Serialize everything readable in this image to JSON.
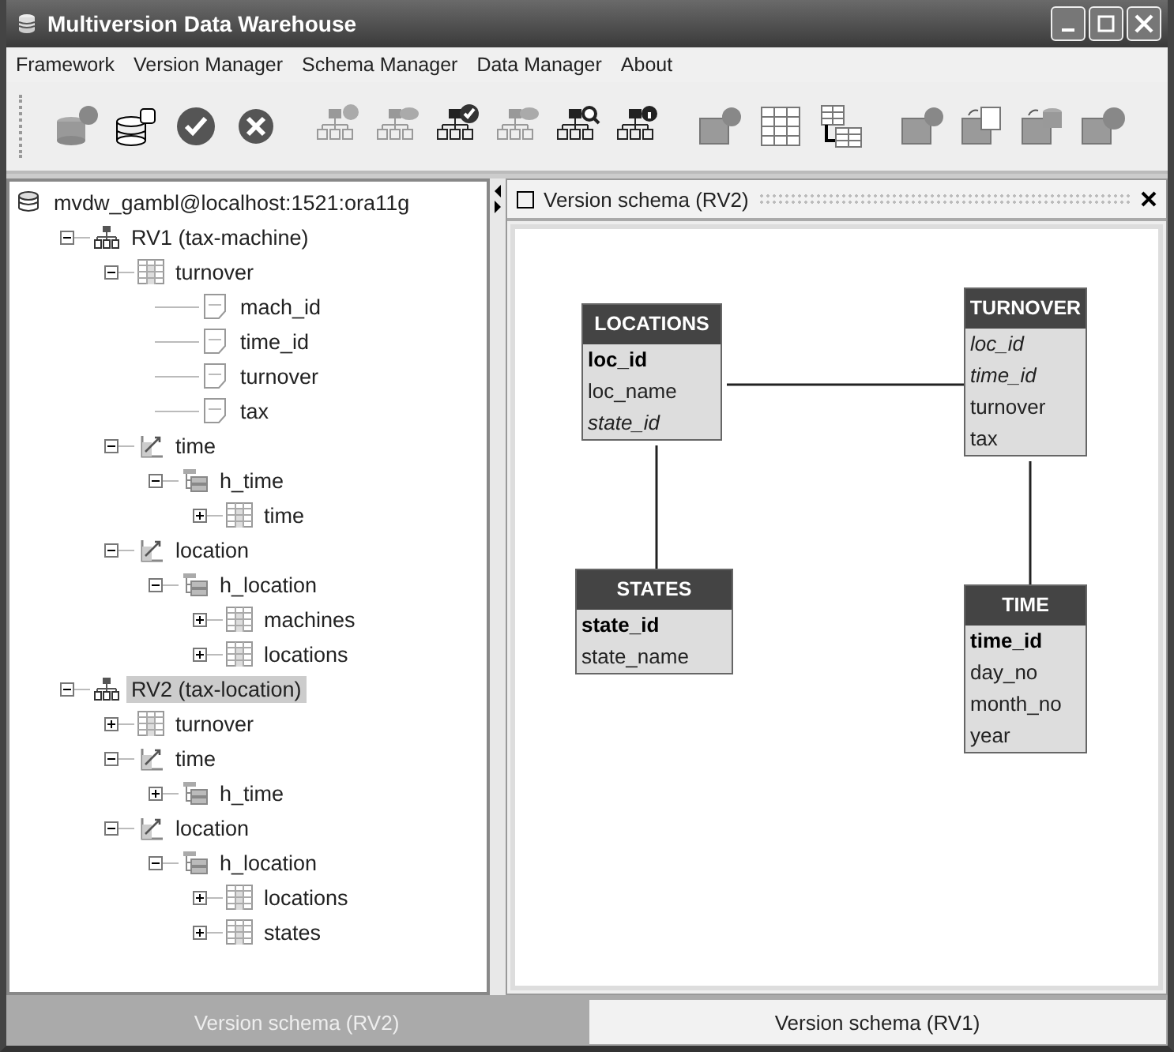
{
  "window": {
    "title": "Multiversion Data Warehouse"
  },
  "menu": [
    "Framework",
    "Version Manager",
    "Schema Manager",
    "Data Manager",
    "About"
  ],
  "toolbar": [
    [
      {
        "kind": "db-add"
      },
      {
        "kind": "db-connect"
      },
      {
        "kind": "ok"
      },
      {
        "kind": "cancel"
      }
    ],
    [
      {
        "kind": "version-add"
      },
      {
        "kind": "version-edit"
      },
      {
        "kind": "version-check"
      },
      {
        "kind": "version-remove"
      },
      {
        "kind": "version-search"
      },
      {
        "kind": "version-info"
      }
    ],
    [
      {
        "kind": "cube-search"
      },
      {
        "kind": "table"
      },
      {
        "kind": "table-link"
      }
    ],
    [
      {
        "kind": "cube-search"
      },
      {
        "kind": "cube-undo"
      },
      {
        "kind": "cube-db"
      },
      {
        "kind": "cube-play"
      }
    ]
  ],
  "tree": {
    "label": "mvdw_gambl@localhost:1521:ora11g",
    "kind": "database",
    "selected": false,
    "children": [
      {
        "label": "RV1 (tax-machine)",
        "kind": "version",
        "expanded": true,
        "selected": false,
        "children": [
          {
            "label": "turnover",
            "kind": "table",
            "expanded": true,
            "selected": false,
            "children": [
              {
                "label": "mach_id",
                "kind": "column",
                "selected": false
              },
              {
                "label": "time_id",
                "kind": "column",
                "selected": false
              },
              {
                "label": "turnover",
                "kind": "column",
                "selected": false
              },
              {
                "label": "tax",
                "kind": "column",
                "selected": false
              }
            ]
          },
          {
            "label": "time",
            "kind": "dimension",
            "expanded": true,
            "selected": false,
            "children": [
              {
                "label": "h_time",
                "kind": "hierarchy",
                "expanded": true,
                "selected": false,
                "children": [
                  {
                    "label": "time",
                    "kind": "table",
                    "expanded": false,
                    "selected": false
                  }
                ]
              }
            ]
          },
          {
            "label": "location",
            "kind": "dimension",
            "expanded": true,
            "selected": false,
            "children": [
              {
                "label": "h_location",
                "kind": "hierarchy",
                "expanded": true,
                "selected": false,
                "children": [
                  {
                    "label": "machines",
                    "kind": "table",
                    "expanded": false,
                    "selected": false
                  },
                  {
                    "label": "locations",
                    "kind": "table",
                    "expanded": false,
                    "selected": false
                  }
                ]
              }
            ]
          }
        ]
      },
      {
        "label": "RV2 (tax-location)",
        "kind": "version",
        "expanded": true,
        "selected": true,
        "children": [
          {
            "label": "turnover",
            "kind": "table",
            "expanded": false,
            "selected": false
          },
          {
            "label": "time",
            "kind": "dimension",
            "expanded": true,
            "selected": false,
            "children": [
              {
                "label": "h_time",
                "kind": "hierarchy",
                "expanded": false,
                "selected": false
              }
            ]
          },
          {
            "label": "location",
            "kind": "dimension",
            "expanded": true,
            "selected": false,
            "children": [
              {
                "label": "h_location",
                "kind": "hierarchy",
                "expanded": true,
                "selected": false,
                "children": [
                  {
                    "label": "locations",
                    "kind": "table",
                    "expanded": false,
                    "selected": false
                  },
                  {
                    "label": "states",
                    "kind": "table",
                    "expanded": false,
                    "selected": false
                  }
                ]
              }
            ]
          }
        ]
      }
    ]
  },
  "schema_panel": {
    "title": "Version schema (RV2)",
    "entities": [
      {
        "name": "LOCATIONS",
        "attributes": [
          {
            "name": "loc_id",
            "kind": "key"
          },
          {
            "name": "loc_name",
            "kind": "plain"
          },
          {
            "name": "state_id",
            "kind": "foreign"
          }
        ]
      },
      {
        "name": "TURNOVER",
        "attributes": [
          {
            "name": "loc_id",
            "kind": "foreign"
          },
          {
            "name": "time_id",
            "kind": "foreign"
          },
          {
            "name": "turnover",
            "kind": "plain"
          },
          {
            "name": "tax",
            "kind": "plain"
          }
        ]
      },
      {
        "name": "STATES",
        "attributes": [
          {
            "name": "state_id",
            "kind": "key"
          },
          {
            "name": "state_name",
            "kind": "plain"
          }
        ]
      },
      {
        "name": "TIME",
        "attributes": [
          {
            "name": "time_id",
            "kind": "key"
          },
          {
            "name": "day_no",
            "kind": "plain"
          },
          {
            "name": "month_no",
            "kind": "plain"
          },
          {
            "name": "year",
            "kind": "plain"
          }
        ]
      }
    ]
  },
  "bottom_tabs": [
    {
      "label": "Version schema (RV2)",
      "selected": true
    },
    {
      "label": "Version schema (RV1)",
      "selected": false
    }
  ]
}
